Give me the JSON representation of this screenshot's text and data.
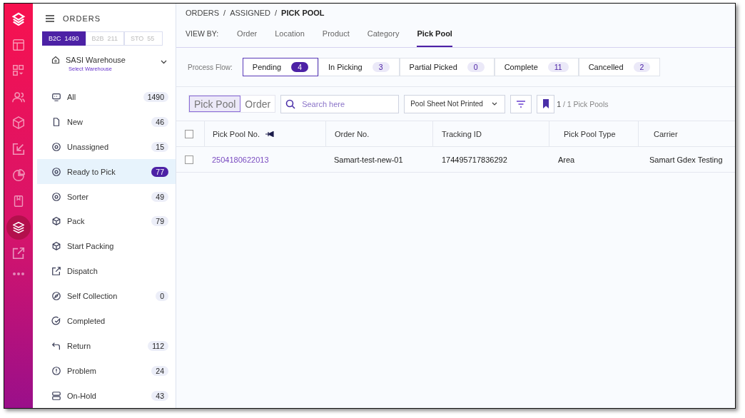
{
  "rail": [
    {
      "selected": false
    },
    {
      "selected": false
    },
    {
      "selected": false
    },
    {
      "selected": false
    },
    {
      "selected": false
    },
    {
      "selected": false
    },
    {
      "selected": false
    },
    {
      "selected": false
    },
    {
      "selected": true
    },
    {
      "selected": false
    }
  ],
  "sidebar": {
    "title": "ORDERS",
    "channels": [
      {
        "label": "B2C",
        "count": "1490",
        "selected": true
      },
      {
        "label": "B2B",
        "count": "211",
        "selected": false
      },
      {
        "label": "STO",
        "count": "55",
        "selected": false
      }
    ],
    "warehouse": {
      "name": "SASI Warehouse",
      "hint": "Select Warehouse"
    },
    "items": [
      {
        "label": "All",
        "count": "1490",
        "selected": false
      },
      {
        "label": "New",
        "count": "46",
        "selected": false
      },
      {
        "label": "Unassigned",
        "count": "15",
        "selected": false
      },
      {
        "label": "Ready to Pick",
        "count": "77",
        "selected": true
      },
      {
        "label": "Sorter",
        "count": "49",
        "selected": false
      },
      {
        "label": "Pack",
        "count": "79",
        "selected": false
      },
      {
        "label": "Start Packing",
        "selected": false
      },
      {
        "label": "Dispatch",
        "selected": false
      },
      {
        "label": "Self Collection",
        "count": "0",
        "selected": false
      },
      {
        "label": "Completed",
        "selected": false
      },
      {
        "label": "Return",
        "count": "112",
        "selected": false
      },
      {
        "label": "Problem",
        "count": "24",
        "selected": false
      },
      {
        "label": "On-Hold",
        "count": "43",
        "selected": false
      }
    ]
  },
  "breadcrumb": [
    {
      "kind": "link",
      "text": "ORDERS"
    },
    {
      "kind": "separator",
      "text": "/"
    },
    {
      "kind": "link",
      "text": "ASSIGNED"
    },
    {
      "kind": "separator",
      "text": "/"
    },
    {
      "kind": "current",
      "text": "PICK POOL"
    }
  ],
  "view_by": {
    "label": "VIEW BY:",
    "tabs": [
      {
        "label": "Order",
        "selected": false
      },
      {
        "label": "Location",
        "selected": false
      },
      {
        "label": "Product",
        "selected": false
      },
      {
        "label": "Category",
        "selected": false
      },
      {
        "label": "Pick Pool",
        "selected": true
      }
    ]
  },
  "process_flow": {
    "label": "Process Flow:",
    "steps": [
      {
        "label": "Pending",
        "count": "4",
        "selected": true
      },
      {
        "label": "In Picking",
        "count": "3",
        "selected": false
      },
      {
        "label": "Partial Picked",
        "count": "0",
        "selected": false
      },
      {
        "label": "Complete",
        "count": "11",
        "selected": false
      },
      {
        "label": "Cancelled",
        "count": "2",
        "selected": false
      }
    ]
  },
  "toolbar": {
    "toggle": [
      {
        "label": "Pick Pool",
        "selected": true
      },
      {
        "label": "Order",
        "selected": false
      }
    ],
    "search": {
      "placeholder": "Search here"
    },
    "filter_select": "Pool Sheet Not Printed",
    "page_current": "1",
    "page_rest": "/ 1 Pick Pools"
  },
  "table": {
    "all_checked": false,
    "columns": [
      {
        "label": "Pick Pool No.",
        "pinned": true
      },
      {
        "label": "Order No.",
        "pinned": false
      },
      {
        "label": "Tracking ID",
        "pinned": false
      },
      {
        "label": "Pick Pool Type",
        "pinned": false
      },
      {
        "label": "Carrier",
        "pinned": false
      }
    ],
    "rows": [
      {
        "checked": false,
        "cells": [
          "2504180622013",
          "Samart-test-new-01",
          "174495717836292",
          "Area",
          "Samart Gdex Testing"
        ]
      }
    ]
  }
}
